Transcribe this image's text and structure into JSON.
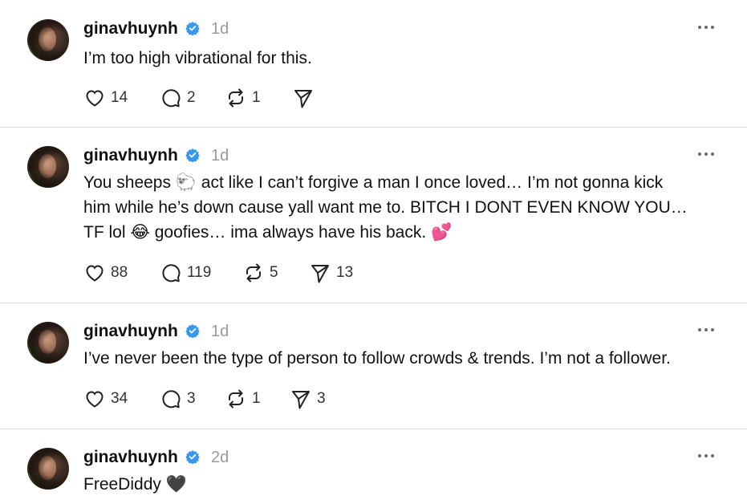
{
  "accent_verified": "#3897f0",
  "posts": [
    {
      "username": "ginavhuynh",
      "time": "1d",
      "lines": [
        "I’m too high vibrational for this."
      ],
      "likes": "14",
      "replies": "2",
      "reposts": "1",
      "shares": ""
    },
    {
      "username": "ginavhuynh",
      "time": "1d",
      "lines": [
        "You sheeps 🐑 act like I can’t forgive a man I once loved… I’m not gonna kick",
        "him while he’s down cause yall want me to. BITCH I DONT EVEN KNOW YOU…",
        "TF lol 😂 goofies… ima always have his back. 💕"
      ],
      "likes": "88",
      "replies": "119",
      "reposts": "5",
      "shares": "13"
    },
    {
      "username": "ginavhuynh",
      "time": "1d",
      "lines": [
        "I’ve never been the type of person to follow crowds & trends. I’m not a follower."
      ],
      "likes": "34",
      "replies": "3",
      "reposts": "1",
      "shares": "3"
    },
    {
      "username": "ginavhuynh",
      "time": "2d",
      "lines": [
        "FreeDiddy 🖤"
      ],
      "likes": "",
      "replies": "",
      "reposts": "",
      "shares": ""
    }
  ]
}
